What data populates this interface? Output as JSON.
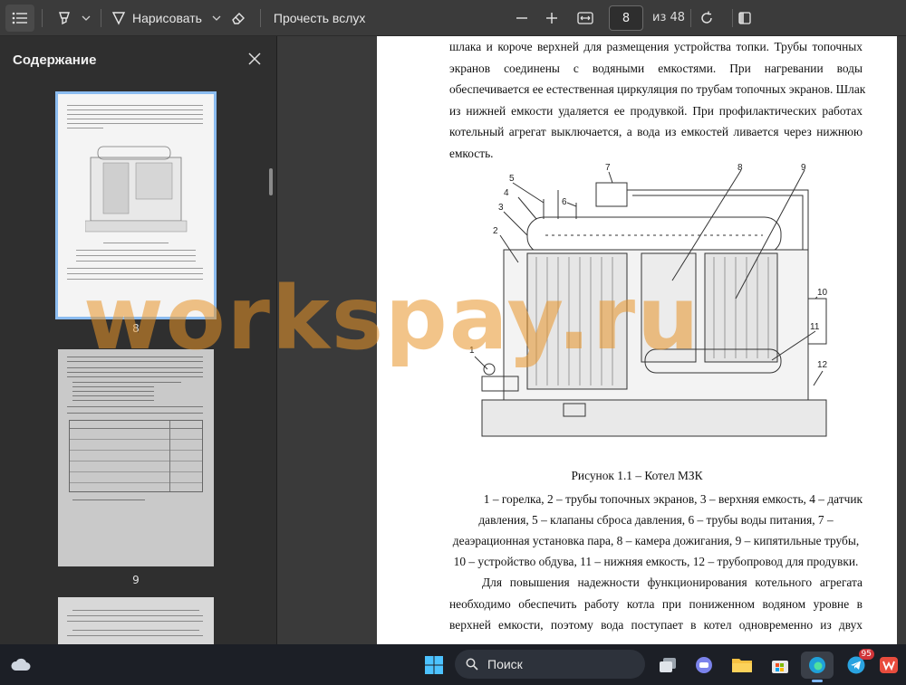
{
  "toolbar": {
    "draw_label": "Нарисовать",
    "read_aloud_label": "Прочесть вслух",
    "page_current": "8",
    "page_total": "из 48"
  },
  "sidebar": {
    "title": "Содержание",
    "thumbnails": [
      {
        "number": "8"
      },
      {
        "number": "9"
      }
    ]
  },
  "document": {
    "para1_lines": [
      "шлака и короче верхней для размещения устройства топки. Трубы топочных",
      "экранов соединены с водяными емкостями. При нагревании воды",
      "обеспечивается ее естественная циркуляция по трубам топочных экранов. Шлак",
      "из нижней емкости удаляется ее продувкой. При профилактических работах",
      "котельный агрегат выключается, а вода из емкостей ливается через нижнюю",
      "емкость."
    ],
    "figure_labels": [
      "1",
      "2",
      "3",
      "4",
      "5",
      "6",
      "7",
      "8",
      "9",
      "10",
      "11",
      "12"
    ],
    "caption": "Рисунок 1.1 – Котел МЗК",
    "legend_lines": [
      "1 – горелка, 2 – трубы топочных экранов, 3 – верхняя емкость, 4 – датчик",
      "давления, 5 – клапаны сброса давления, 6 – трубы воды питания, 7 –",
      "деаэрационная установка пара, 8 – камера дожигания, 9 – кипятильные трубы,",
      "10 – устройство обдува, 11 – нижняя емкость, 12 – трубопровод для продувки."
    ],
    "para2_lines": [
      "Для повышения надежности функционирования котельного агрегата",
      "необходимо обеспечить работу котла при пониженном водяном уровне в",
      "верхней емкости, поэтому вода поступает в котел одновременно из двух"
    ]
  },
  "watermark": "workspay.ru",
  "taskbar": {
    "search_label": "Поиск",
    "telegram_badge": "95"
  },
  "colors": {
    "accent": "#8bbcf0",
    "watermark": "#e89428"
  }
}
